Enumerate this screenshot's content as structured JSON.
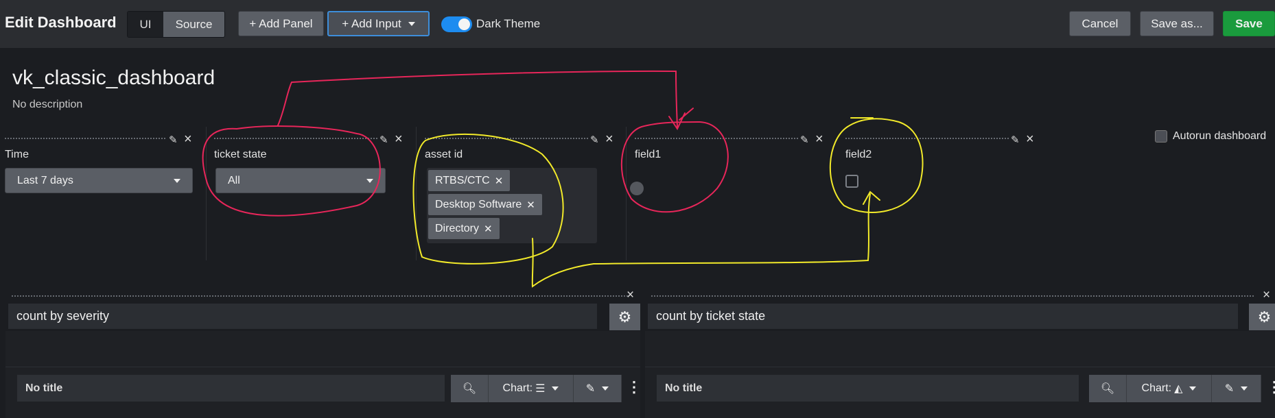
{
  "header": {
    "title": "Edit Dashboard",
    "mode_tabs": [
      "UI",
      "Source"
    ],
    "add_panel": "+ Add Panel",
    "add_input": "+ Add Input",
    "dark_theme_label": "Dark Theme",
    "dark_theme_on": true,
    "cancel": "Cancel",
    "save_as": "Save as...",
    "save": "Save"
  },
  "dashboard": {
    "name": "vk_classic_dashboard",
    "description": "No description",
    "autorun_label": "Autorun dashboard"
  },
  "inputs": {
    "time": {
      "label": "Time",
      "value": "Last 7 days"
    },
    "ticket_state": {
      "label": "ticket state",
      "value": "All"
    },
    "asset_id": {
      "label": "asset id",
      "chips": [
        "RTBS/CTC",
        "Desktop Software",
        "Directory"
      ]
    },
    "field1": {
      "label": "field1"
    },
    "field2": {
      "label": "field2"
    }
  },
  "panels": [
    {
      "title": "count by severity",
      "subtitle": "No title",
      "chart_label": "Chart:"
    },
    {
      "title": "count by ticket state",
      "subtitle": "No title",
      "chart_label": "Chart:"
    }
  ],
  "colors": {
    "accent": "#1d8cf0",
    "save": "#1a9b3d",
    "annotation_red": "#e8265a",
    "annotation_yellow": "#f2ea2a"
  }
}
